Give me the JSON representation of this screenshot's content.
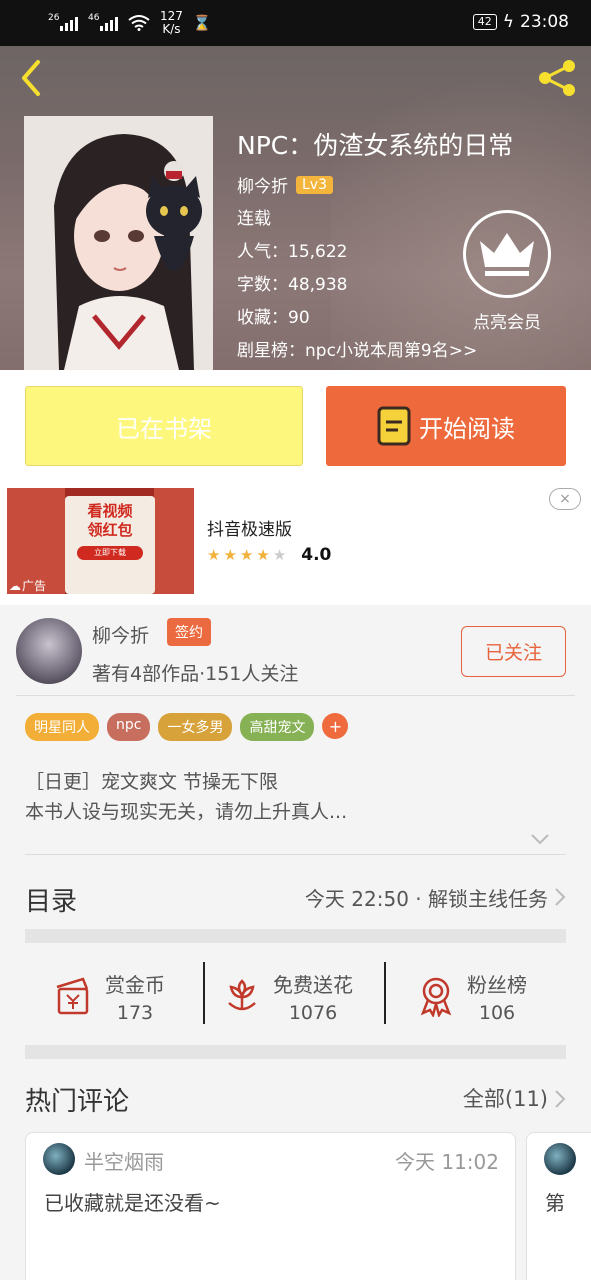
{
  "status_bar": {
    "sim1": "26",
    "sim2": "46",
    "speed_value": "127",
    "speed_unit": "K/s",
    "battery": "42",
    "time": "23:08"
  },
  "book": {
    "title": "NPC：伪渣女系统的日常",
    "author": "柳今折",
    "level": "Lv3",
    "status": "连载",
    "popularity": "人气：15,622",
    "word_count": "字数：48,938",
    "favorites": "收藏：90",
    "rank": "剧星榜：npc小说本周第9名>>",
    "vip_label": "点亮会员"
  },
  "actions": {
    "shelf_label": "已在书架",
    "read_label": "开始阅读"
  },
  "ad": {
    "badge": "广告",
    "img_text1": "看视频",
    "img_text2": "领红包",
    "img_text3": "立即下载",
    "app_name": "抖音极速版",
    "rating": "4.0",
    "stars_filled": 4,
    "close": "×"
  },
  "author_card": {
    "name": "柳今折",
    "badge": "签约",
    "stats": "著有4部作品·151人关注",
    "follow_label": "已关注"
  },
  "tags": [
    {
      "label": "明星同人",
      "color": "#f2ae36"
    },
    {
      "label": "npc",
      "color": "#c86e5e"
    },
    {
      "label": "一女多男",
      "color": "#d8a23a"
    },
    {
      "label": "高甜宠文",
      "color": "#86b154"
    }
  ],
  "tag_add": "+",
  "description": {
    "line1": "［日更］宠文爽文 节操无下限",
    "line2": "本书人设与现实无关，请勿上升真人..."
  },
  "toc": {
    "title": "目录",
    "latest": "今天 22:50 · 解锁主线任务"
  },
  "gifts": [
    {
      "label": "赏金币",
      "count": "173",
      "icon": "reward-coin-icon"
    },
    {
      "label": "免费送花",
      "count": "1076",
      "icon": "flower-icon"
    },
    {
      "label": "粉丝榜",
      "count": "106",
      "icon": "medal-icon"
    }
  ],
  "comments": {
    "title": "热门评论",
    "all_label": "全部(11)",
    "items": [
      {
        "user": "半空烟雨",
        "time": "今天 11:02",
        "text": "已收藏就是还没看~"
      },
      {
        "text": "第"
      }
    ]
  },
  "colors": {
    "accent": "#ee6a3c",
    "shelf_button": "#fdf77d",
    "level_badge": "#f3b53b",
    "icon_red": "#c0392b"
  }
}
